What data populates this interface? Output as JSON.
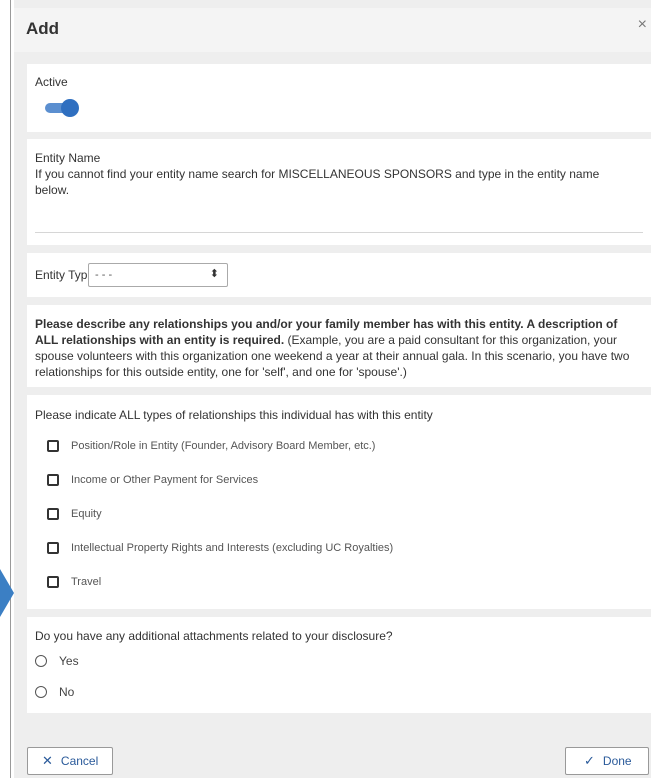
{
  "modal": {
    "title": "Add",
    "close_icon": "×"
  },
  "active": {
    "label": "Active",
    "toggle_on": true
  },
  "entity_name": {
    "label": "Entity Name",
    "help": "If you cannot find your entity name search for MISCELLANEOUS SPONSORS and type in the entity name below.",
    "value": ""
  },
  "entity_type": {
    "label": "Entity Type",
    "selected": "- - -",
    "arrow": "⬍"
  },
  "description": {
    "bold": "Please describe any relationships you and/or your family member has with this entity. A description of ALL relationships with an entity is required.",
    "normal": " (Example, you are a paid consultant for this organization, your spouse volunteers with this organization one weekend a year at their annual gala. In this scenario, you have two relationships for this outside entity, one for 'self', and one for 'spouse'.)"
  },
  "relationships": {
    "label": "Please indicate ALL types of relationships this individual has with this entity",
    "options": [
      "Position/Role in Entity (Founder, Advisory Board Member, etc.)",
      "Income or Other Payment for Services",
      "Equity",
      "Intellectual Property Rights and Interests (excluding UC Royalties)",
      "Travel"
    ]
  },
  "attachments": {
    "question": "Do you have any additional attachments related to your disclosure?",
    "options": [
      "Yes",
      "No"
    ]
  },
  "footer": {
    "cancel_label": "Cancel",
    "cancel_icon": "✕",
    "done_label": "Done",
    "done_icon": "✓"
  },
  "colors": {
    "accent": "#2f6fc0",
    "arrow": "#3b7fc4"
  }
}
